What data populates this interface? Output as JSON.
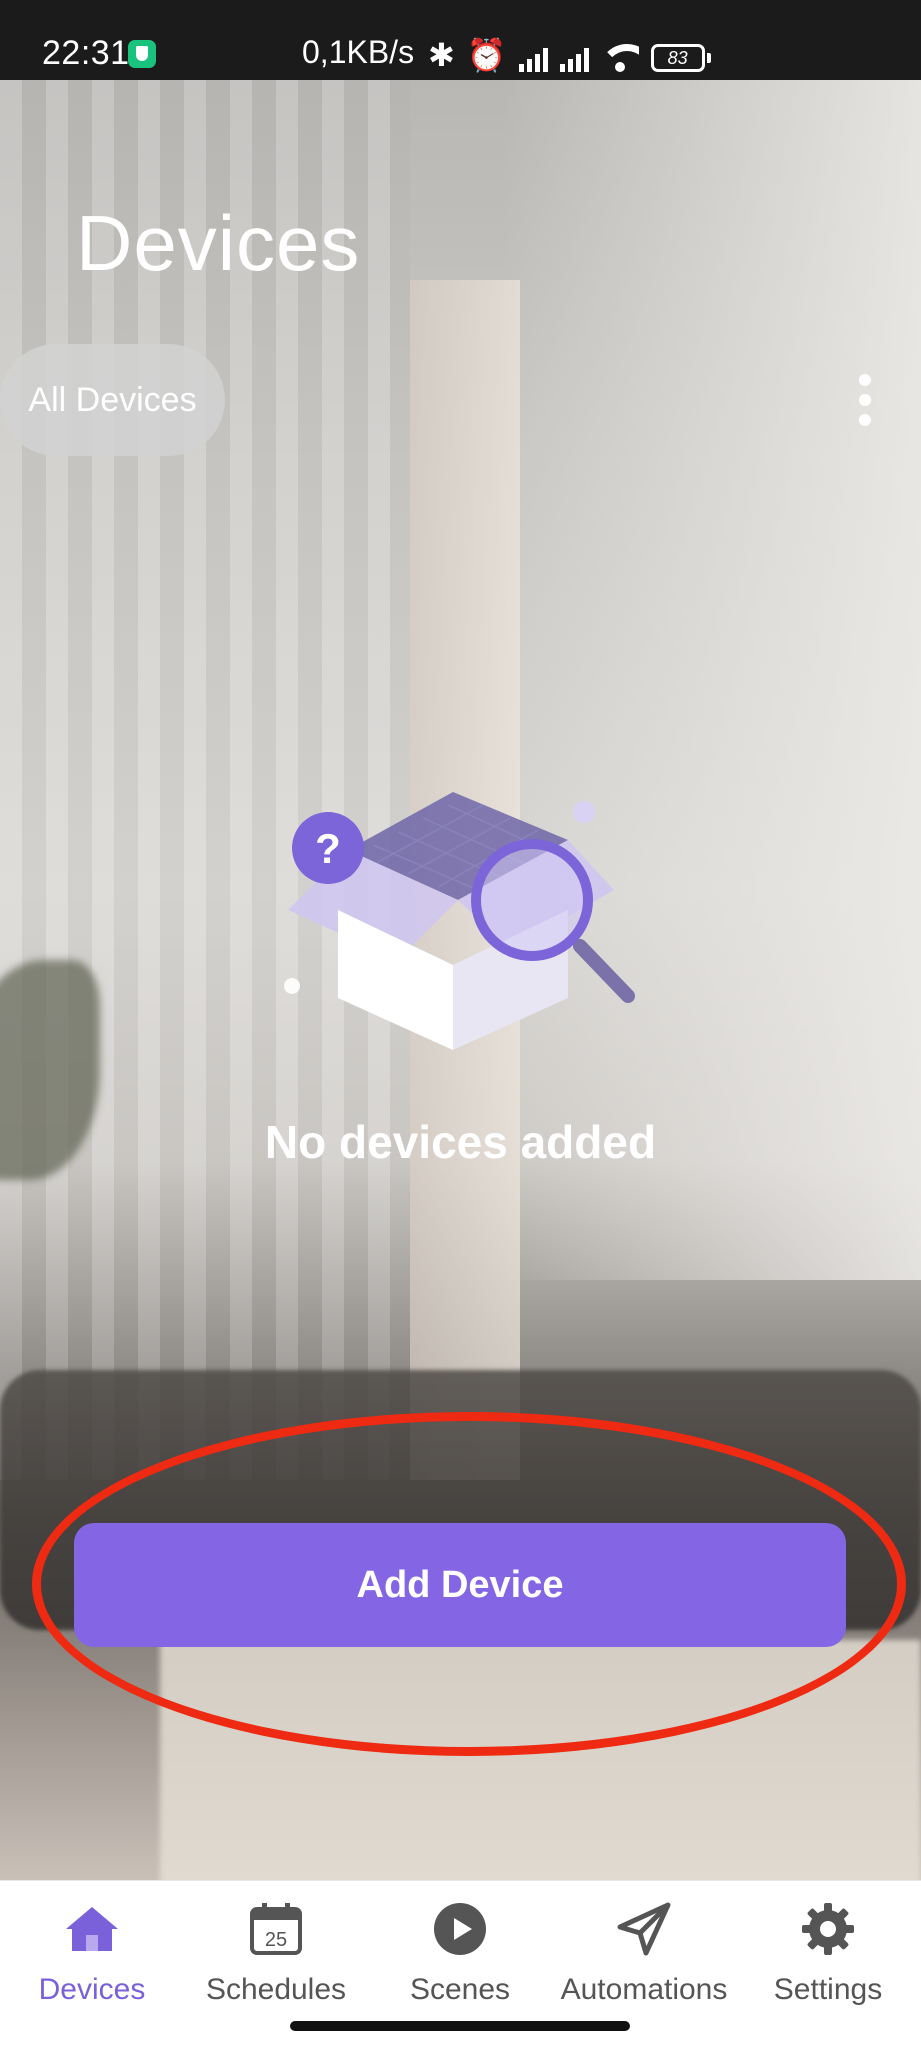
{
  "status_bar": {
    "time": "22:31",
    "network_rate": "0,1KB/s",
    "battery_level": "83",
    "icons": [
      "shield-icon",
      "bluetooth-icon",
      "alarm-icon",
      "signal-icon",
      "signal-icon",
      "wifi-icon",
      "battery-icon"
    ]
  },
  "header": {
    "title": "Devices"
  },
  "filter": {
    "selected_label": "All Devices"
  },
  "empty_state": {
    "message": "No devices added",
    "illustration": "empty-box-search-illustration"
  },
  "actions": {
    "add_device_label": "Add Device"
  },
  "bottom_nav": {
    "items": [
      {
        "label": "Devices",
        "icon": "home-icon",
        "active": true
      },
      {
        "label": "Schedules",
        "icon": "calendar-icon",
        "calendar_day": "25",
        "active": false
      },
      {
        "label": "Scenes",
        "icon": "play-icon",
        "active": false
      },
      {
        "label": "Automations",
        "icon": "send-icon",
        "active": false
      },
      {
        "label": "Settings",
        "icon": "gear-icon",
        "active": false
      }
    ]
  },
  "colors": {
    "accent": "#8466E4",
    "active_nav": "#7B61D9",
    "highlight_ring": "#EE2A12",
    "inactive_nav": "#555555"
  }
}
